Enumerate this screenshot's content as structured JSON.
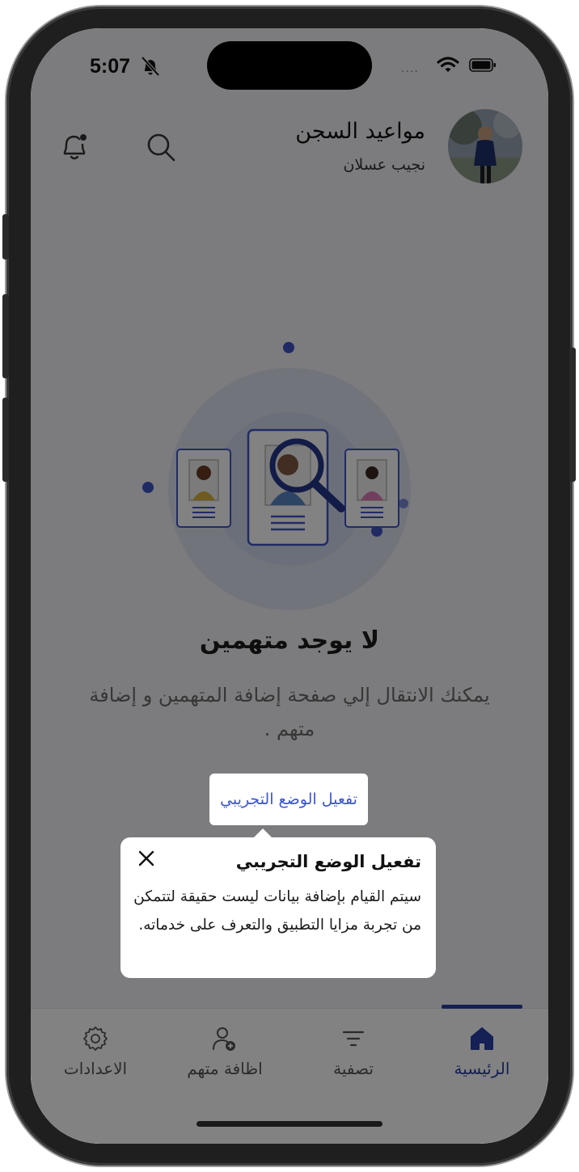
{
  "status_bar": {
    "time": "5:07",
    "signal": "...."
  },
  "header": {
    "title": "مواعيد السجن",
    "subtitle": "نجيب عسلان"
  },
  "empty_state": {
    "title": "لا يوجد متهمين",
    "description": "يمكنك الانتقال إلي صفحة إضافة المتهمين و إضافة متهم ."
  },
  "demo_button": {
    "label": "تفعيل الوضع التجريبي"
  },
  "tooltip": {
    "title": "تفعيل الوضع التجريبي",
    "body": "سيتم القيام بإضافة بيانات ليست حقيقة لتتمكن من تجربة مزايا التطبيق والتعرف على خدماته."
  },
  "tabs": [
    {
      "label": "الرئيسية",
      "icon": "home-icon",
      "active": true
    },
    {
      "label": "تصفية",
      "icon": "filter-icon",
      "active": false
    },
    {
      "label": "اظافة متهم",
      "icon": "add-user-icon",
      "active": false
    },
    {
      "label": "الاعدادات",
      "icon": "gear-icon",
      "active": false
    }
  ],
  "colors": {
    "accent": "#2a3fa6",
    "button_text": "#3a55d6",
    "overlay": "rgba(0,0,0,0.49)"
  }
}
